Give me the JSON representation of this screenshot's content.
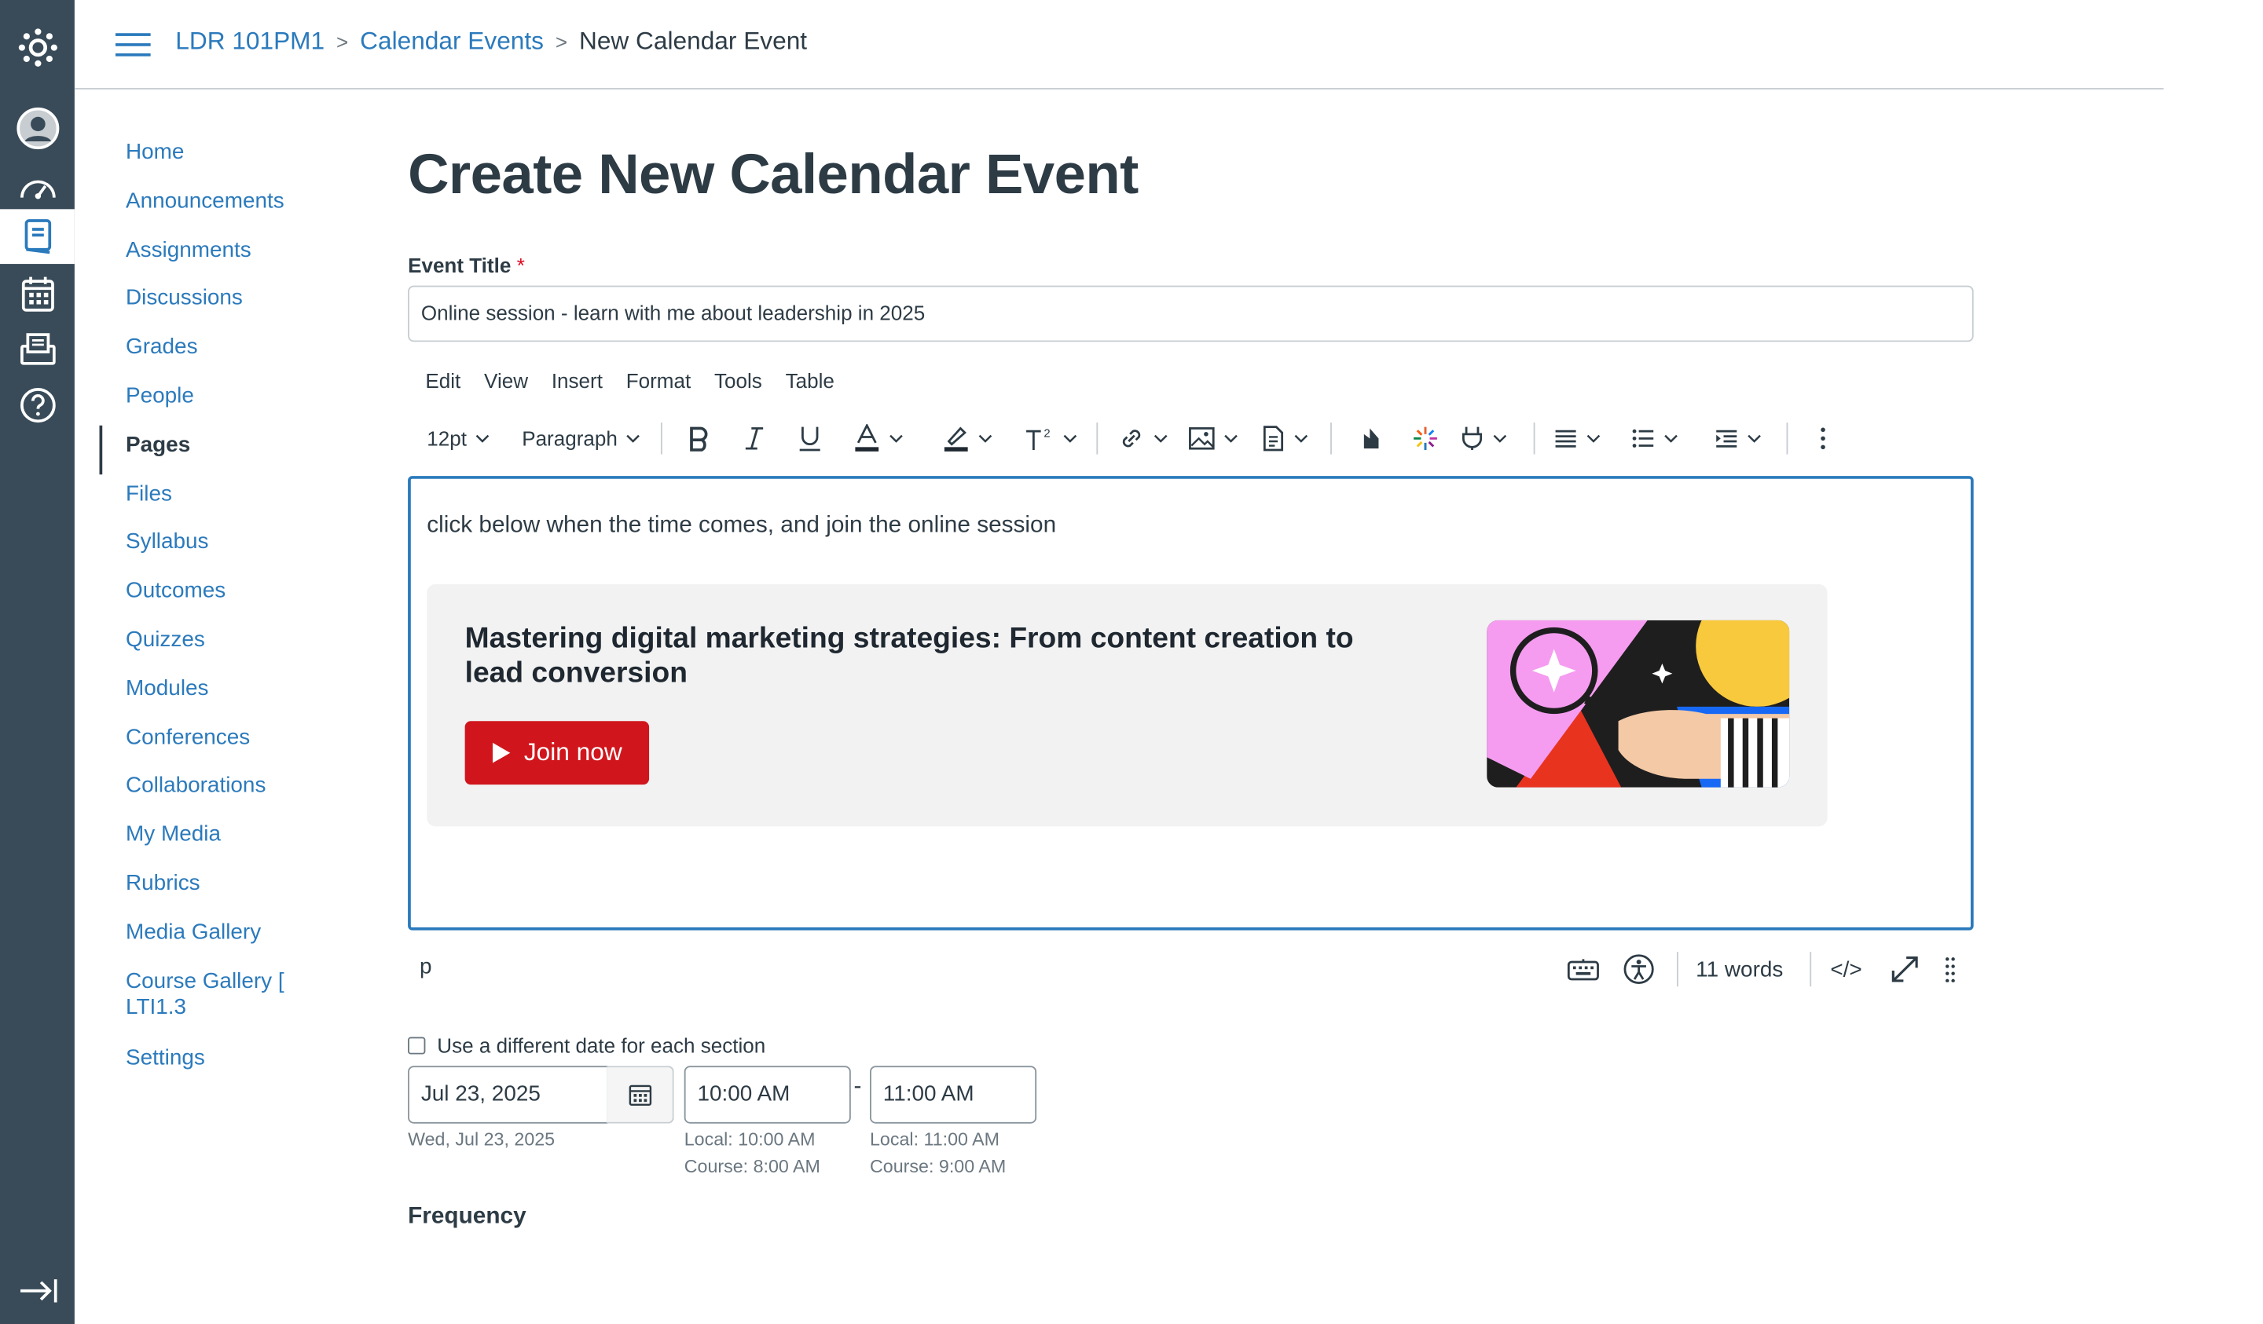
{
  "breadcrumb": [
    "LDR 101PM1",
    "Calendar Events",
    "New Calendar Event"
  ],
  "course_nav": [
    {
      "label": "Home",
      "active": false
    },
    {
      "label": "Announcements",
      "active": false
    },
    {
      "label": "Assignments",
      "active": false
    },
    {
      "label": "Discussions",
      "active": false
    },
    {
      "label": "Grades",
      "active": false
    },
    {
      "label": "People",
      "active": false
    },
    {
      "label": "Pages",
      "active": true
    },
    {
      "label": "Files",
      "active": false
    },
    {
      "label": "Syllabus",
      "active": false
    },
    {
      "label": "Outcomes",
      "active": false
    },
    {
      "label": "Quizzes",
      "active": false
    },
    {
      "label": "Modules",
      "active": false
    },
    {
      "label": "Conferences",
      "active": false
    },
    {
      "label": "Collaborations",
      "active": false
    },
    {
      "label": "My Media",
      "active": false
    },
    {
      "label": "Rubrics",
      "active": false
    },
    {
      "label": "Media Gallery",
      "active": false
    },
    {
      "label": "Course Gallery [ LTI1.3",
      "active": false
    },
    {
      "label": "Settings",
      "active": false
    }
  ],
  "page": {
    "title": "Create New Calendar Event"
  },
  "event_title": {
    "label": "Event Title",
    "required_mark": "*",
    "value": "Online session - learn with me about leadership in 2025"
  },
  "editor": {
    "menu": [
      "Edit",
      "View",
      "Insert",
      "Format",
      "Tools",
      "Table"
    ],
    "font_size": "12pt",
    "block_format": "Paragraph",
    "body_text": "click below when the time comes, and join the online session",
    "card": {
      "title": "Mastering digital marketing strategies: From content creation to lead conversion",
      "button_label": "Join now"
    },
    "status": {
      "element_path": "p",
      "word_count": "11 words",
      "html_toggle": "</>"
    }
  },
  "different_date": {
    "label": "Use a different date for each section",
    "checked": false
  },
  "date": {
    "value": "Jul 23, 2025",
    "hint": "Wed, Jul 23, 2025"
  },
  "start_time": {
    "value": "10:00 AM",
    "local": "Local: 10:00 AM",
    "course": "Course: 8:00 AM"
  },
  "time_separator": "-",
  "end_time": {
    "value": "11:00 AM",
    "local": "Local: 11:00 AM",
    "course": "Course: 9:00 AM"
  },
  "frequency": {
    "label": "Frequency"
  },
  "colors": {
    "brand_blue": "#2b7abc",
    "nav_bg": "#394b58",
    "join_red": "#d0161c",
    "text": "#2d3b45"
  }
}
